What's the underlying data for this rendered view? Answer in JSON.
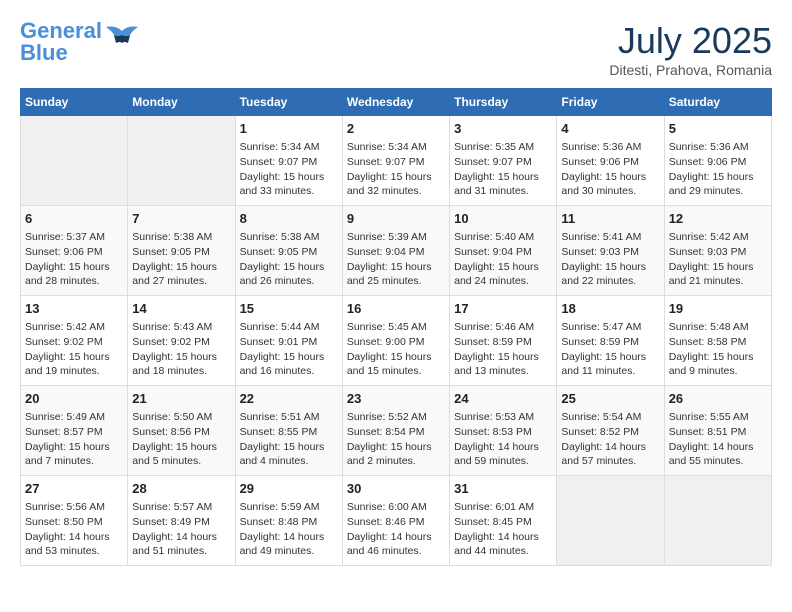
{
  "header": {
    "logo_line1": "General",
    "logo_line2": "Blue",
    "month": "July 2025",
    "location": "Ditesti, Prahova, Romania"
  },
  "days_of_week": [
    "Sunday",
    "Monday",
    "Tuesday",
    "Wednesday",
    "Thursday",
    "Friday",
    "Saturday"
  ],
  "weeks": [
    [
      {
        "day": "",
        "info": ""
      },
      {
        "day": "",
        "info": ""
      },
      {
        "day": "1",
        "info": "Sunrise: 5:34 AM\nSunset: 9:07 PM\nDaylight: 15 hours\nand 33 minutes."
      },
      {
        "day": "2",
        "info": "Sunrise: 5:34 AM\nSunset: 9:07 PM\nDaylight: 15 hours\nand 32 minutes."
      },
      {
        "day": "3",
        "info": "Sunrise: 5:35 AM\nSunset: 9:07 PM\nDaylight: 15 hours\nand 31 minutes."
      },
      {
        "day": "4",
        "info": "Sunrise: 5:36 AM\nSunset: 9:06 PM\nDaylight: 15 hours\nand 30 minutes."
      },
      {
        "day": "5",
        "info": "Sunrise: 5:36 AM\nSunset: 9:06 PM\nDaylight: 15 hours\nand 29 minutes."
      }
    ],
    [
      {
        "day": "6",
        "info": "Sunrise: 5:37 AM\nSunset: 9:06 PM\nDaylight: 15 hours\nand 28 minutes."
      },
      {
        "day": "7",
        "info": "Sunrise: 5:38 AM\nSunset: 9:05 PM\nDaylight: 15 hours\nand 27 minutes."
      },
      {
        "day": "8",
        "info": "Sunrise: 5:38 AM\nSunset: 9:05 PM\nDaylight: 15 hours\nand 26 minutes."
      },
      {
        "day": "9",
        "info": "Sunrise: 5:39 AM\nSunset: 9:04 PM\nDaylight: 15 hours\nand 25 minutes."
      },
      {
        "day": "10",
        "info": "Sunrise: 5:40 AM\nSunset: 9:04 PM\nDaylight: 15 hours\nand 24 minutes."
      },
      {
        "day": "11",
        "info": "Sunrise: 5:41 AM\nSunset: 9:03 PM\nDaylight: 15 hours\nand 22 minutes."
      },
      {
        "day": "12",
        "info": "Sunrise: 5:42 AM\nSunset: 9:03 PM\nDaylight: 15 hours\nand 21 minutes."
      }
    ],
    [
      {
        "day": "13",
        "info": "Sunrise: 5:42 AM\nSunset: 9:02 PM\nDaylight: 15 hours\nand 19 minutes."
      },
      {
        "day": "14",
        "info": "Sunrise: 5:43 AM\nSunset: 9:02 PM\nDaylight: 15 hours\nand 18 minutes."
      },
      {
        "day": "15",
        "info": "Sunrise: 5:44 AM\nSunset: 9:01 PM\nDaylight: 15 hours\nand 16 minutes."
      },
      {
        "day": "16",
        "info": "Sunrise: 5:45 AM\nSunset: 9:00 PM\nDaylight: 15 hours\nand 15 minutes."
      },
      {
        "day": "17",
        "info": "Sunrise: 5:46 AM\nSunset: 8:59 PM\nDaylight: 15 hours\nand 13 minutes."
      },
      {
        "day": "18",
        "info": "Sunrise: 5:47 AM\nSunset: 8:59 PM\nDaylight: 15 hours\nand 11 minutes."
      },
      {
        "day": "19",
        "info": "Sunrise: 5:48 AM\nSunset: 8:58 PM\nDaylight: 15 hours\nand 9 minutes."
      }
    ],
    [
      {
        "day": "20",
        "info": "Sunrise: 5:49 AM\nSunset: 8:57 PM\nDaylight: 15 hours\nand 7 minutes."
      },
      {
        "day": "21",
        "info": "Sunrise: 5:50 AM\nSunset: 8:56 PM\nDaylight: 15 hours\nand 5 minutes."
      },
      {
        "day": "22",
        "info": "Sunrise: 5:51 AM\nSunset: 8:55 PM\nDaylight: 15 hours\nand 4 minutes."
      },
      {
        "day": "23",
        "info": "Sunrise: 5:52 AM\nSunset: 8:54 PM\nDaylight: 15 hours\nand 2 minutes."
      },
      {
        "day": "24",
        "info": "Sunrise: 5:53 AM\nSunset: 8:53 PM\nDaylight: 14 hours\nand 59 minutes."
      },
      {
        "day": "25",
        "info": "Sunrise: 5:54 AM\nSunset: 8:52 PM\nDaylight: 14 hours\nand 57 minutes."
      },
      {
        "day": "26",
        "info": "Sunrise: 5:55 AM\nSunset: 8:51 PM\nDaylight: 14 hours\nand 55 minutes."
      }
    ],
    [
      {
        "day": "27",
        "info": "Sunrise: 5:56 AM\nSunset: 8:50 PM\nDaylight: 14 hours\nand 53 minutes."
      },
      {
        "day": "28",
        "info": "Sunrise: 5:57 AM\nSunset: 8:49 PM\nDaylight: 14 hours\nand 51 minutes."
      },
      {
        "day": "29",
        "info": "Sunrise: 5:59 AM\nSunset: 8:48 PM\nDaylight: 14 hours\nand 49 minutes."
      },
      {
        "day": "30",
        "info": "Sunrise: 6:00 AM\nSunset: 8:46 PM\nDaylight: 14 hours\nand 46 minutes."
      },
      {
        "day": "31",
        "info": "Sunrise: 6:01 AM\nSunset: 8:45 PM\nDaylight: 14 hours\nand 44 minutes."
      },
      {
        "day": "",
        "info": ""
      },
      {
        "day": "",
        "info": ""
      }
    ]
  ]
}
